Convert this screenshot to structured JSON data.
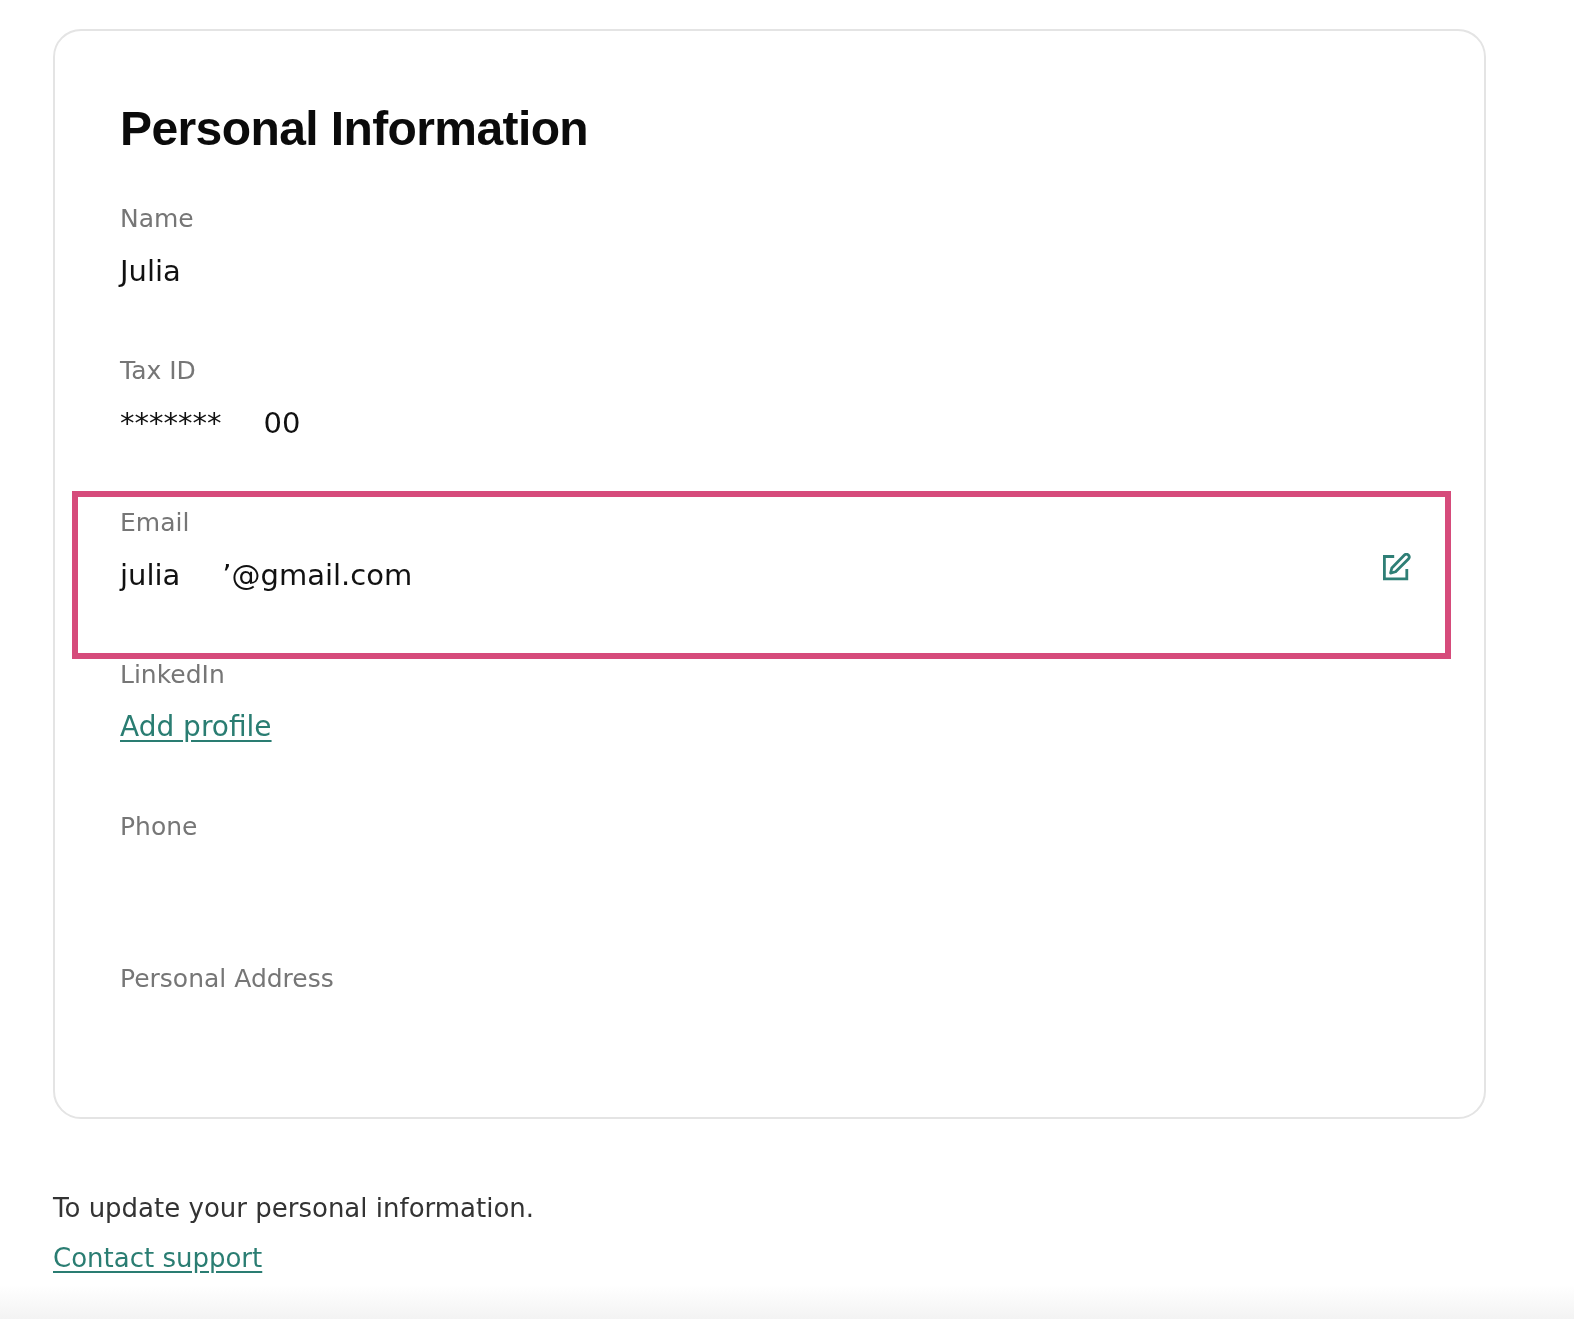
{
  "card": {
    "title": "Personal Information",
    "fields": [
      {
        "label": "Name",
        "kind": "text",
        "value_parts": [
          "Julia"
        ],
        "highlighted": false,
        "editable": false
      },
      {
        "label": "Tax ID",
        "kind": "text",
        "value_parts": [
          "*******",
          "00"
        ],
        "highlighted": false,
        "editable": false
      },
      {
        "label": "Email",
        "kind": "text",
        "value_parts": [
          "julia",
          "’@gmail.com"
        ],
        "highlighted": true,
        "editable": true
      },
      {
        "label": "LinkedIn",
        "kind": "link",
        "value_parts": [
          "Add profile"
        ],
        "highlighted": false,
        "editable": false
      },
      {
        "label": "Phone",
        "kind": "text",
        "highlighted": false,
        "editable": false
      },
      {
        "label": "Personal Address",
        "kind": "text",
        "highlighted": false,
        "editable": false
      }
    ]
  },
  "footer": {
    "note": "To update your personal information.",
    "link": "Contact support"
  }
}
